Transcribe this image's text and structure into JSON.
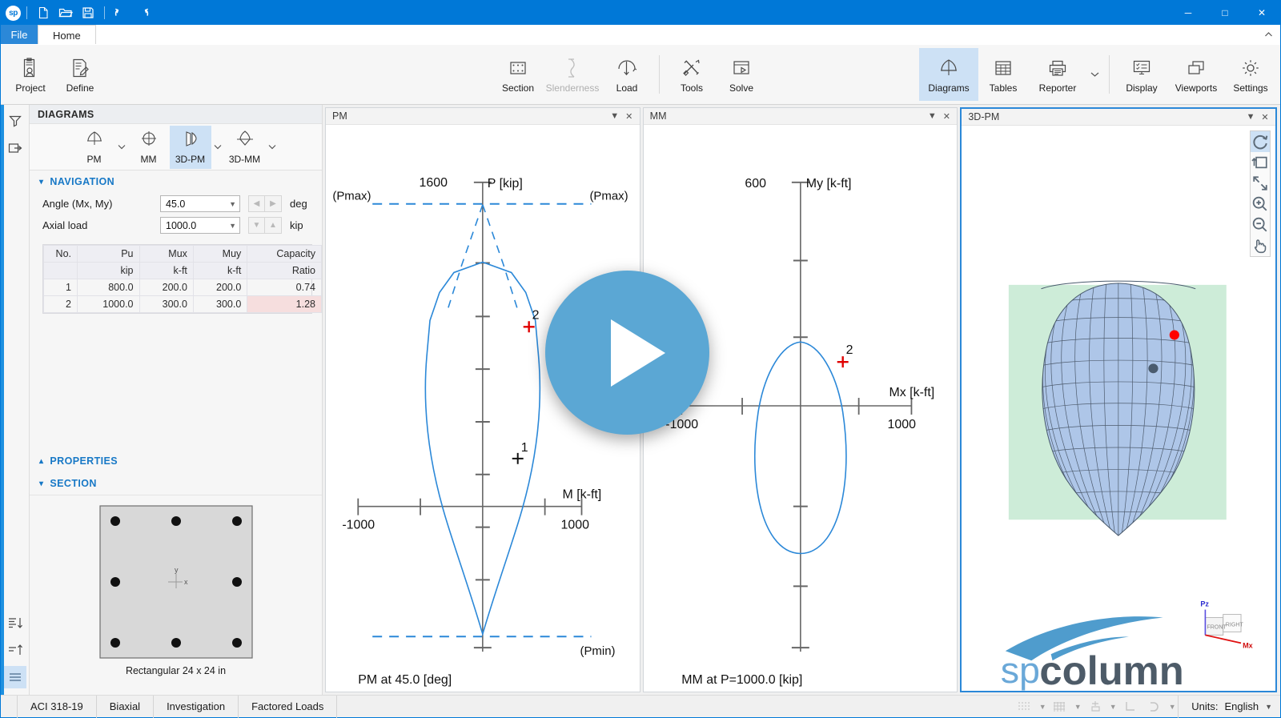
{
  "window": {
    "quick_access": [
      "sp-logo",
      "new-icon",
      "open-icon",
      "save-icon",
      "undo-icon",
      "redo-icon"
    ],
    "minimize": "─",
    "maximize": "□",
    "close": "✕"
  },
  "tabs": {
    "file": "File",
    "home": "Home"
  },
  "ribbon": {
    "left": [
      {
        "label": "Project",
        "icon": "project-icon",
        "state": "normal"
      },
      {
        "label": "Define",
        "icon": "define-icon",
        "state": "normal"
      }
    ],
    "center": [
      {
        "label": "Section",
        "icon": "section-icon",
        "state": "normal"
      },
      {
        "label": "Slenderness",
        "icon": "slenderness-icon",
        "state": "disabled"
      },
      {
        "label": "Load",
        "icon": "load-icon",
        "state": "normal"
      },
      {
        "label": "Tools",
        "icon": "tools-icon",
        "state": "normal"
      },
      {
        "label": "Solve",
        "icon": "solve-icon",
        "state": "normal"
      }
    ],
    "right": [
      {
        "label": "Diagrams",
        "icon": "diagrams-icon",
        "state": "active"
      },
      {
        "label": "Tables",
        "icon": "tables-icon",
        "state": "normal"
      },
      {
        "label": "Reporter",
        "icon": "reporter-icon",
        "state": "normal"
      },
      {
        "label": "Display",
        "icon": "display-icon",
        "state": "normal"
      },
      {
        "label": "Viewports",
        "icon": "viewports-icon",
        "state": "normal"
      },
      {
        "label": "Settings",
        "icon": "settings-icon",
        "state": "normal"
      }
    ]
  },
  "left_panel": {
    "title": "DIAGRAMS",
    "diagram_buttons": [
      {
        "label": "PM",
        "active": false,
        "caret": true
      },
      {
        "label": "MM",
        "active": false,
        "caret": false
      },
      {
        "label": "3D-PM",
        "active": true,
        "caret": true
      },
      {
        "label": "3D-MM",
        "active": false,
        "caret": true
      }
    ],
    "navigation": {
      "header": "NAVIGATION",
      "angle_label": "Angle (Mx, My)",
      "angle_value": "45.0",
      "angle_unit": "deg",
      "axial_label": "Axial load",
      "axial_value": "1000.0",
      "axial_unit": "kip"
    },
    "table": {
      "headers": [
        "No.",
        "Pu",
        "Mux",
        "Muy",
        "Capacity"
      ],
      "units": [
        "",
        "kip",
        "k-ft",
        "k-ft",
        "Ratio"
      ],
      "rows": [
        {
          "cells": [
            "1",
            "800.0",
            "200.0",
            "200.0",
            "0.74"
          ],
          "highlight": false
        },
        {
          "cells": [
            "2",
            "1000.0",
            "300.0",
            "300.0",
            "1.28"
          ],
          "highlight": true
        }
      ]
    },
    "properties_header": "PROPERTIES",
    "section_header": "SECTION",
    "section_caption": "Rectangular 24 x 24 in",
    "section_axis_x": "x",
    "section_axis_y": "y"
  },
  "panes": [
    {
      "title": "PM",
      "has_caret": true,
      "has_close": true,
      "focused": false
    },
    {
      "title": "MM",
      "has_caret": true,
      "has_close": true,
      "focused": false
    },
    {
      "title": "3D-PM",
      "has_caret": true,
      "has_close": true,
      "focused": true
    }
  ],
  "view_tools": [
    "rotate-icon",
    "orbit-icon",
    "zoom-extents-icon",
    "zoom-in-icon",
    "zoom-out-icon",
    "pan-icon"
  ],
  "axis_triad": {
    "z": "Pz",
    "x": "Mx",
    "front": "FRONT",
    "right": "RIGHT"
  },
  "logo": {
    "sp": "sp",
    "column": "column"
  },
  "status_bar": {
    "cells": [
      "ACI 318-19",
      "Biaxial",
      "Investigation",
      "Factored Loads"
    ],
    "icons": [
      "dot-grid-icon",
      "grid-icon",
      "snap-icon",
      "ortho-icon",
      "magnet-icon"
    ],
    "units_label": "Units:",
    "units_value": "English"
  },
  "chart_data": [
    {
      "type": "line",
      "id": "pm-diagram",
      "title": "PM at 45.0 [deg]",
      "xlabel": "M [k-ft]",
      "ylabel": "P [kip]",
      "xlim": [
        -1400,
        1400
      ],
      "ylim": [
        -700,
        1600
      ],
      "x_ticks": [
        -1000,
        -500,
        0,
        500,
        1000
      ],
      "x_tick_labels": {
        "-1000": "-1000",
        "1000": "1000"
      },
      "y_axis_top_label": "1600",
      "annotations": [
        {
          "text": "(Pmax)",
          "side": "left"
        },
        {
          "text": "(Pmax)",
          "side": "right"
        },
        {
          "text": "(Pmin)",
          "side": "right"
        }
      ],
      "points": [
        {
          "label": "1",
          "x": 283,
          "y": 800,
          "color": "#000000"
        },
        {
          "label": "2",
          "x": 424,
          "y": 1000,
          "color": "#ff0000"
        }
      ],
      "curve_color": "#1f7fc4",
      "grid": false,
      "legend": "none"
    },
    {
      "type": "line",
      "id": "mm-diagram",
      "title": "MM at P=1000.0 [kip]",
      "xlabel": "Mx [k-ft]",
      "ylabel": "My [k-ft]",
      "xlim": [
        -1400,
        1400
      ],
      "ylim": [
        -1600,
        600
      ],
      "x_ticks": [
        -1000,
        -500,
        0,
        500,
        1000
      ],
      "x_tick_labels": {
        "-1000": "-1000",
        "1000": "1000"
      },
      "y_axis_top_label": "600",
      "points": [
        {
          "label": "2",
          "x": 300,
          "y": 300,
          "color": "#ff0000"
        }
      ],
      "curve_color": "#1f7fc4",
      "grid": false,
      "legend": "none"
    },
    {
      "type": "surface",
      "id": "3d-pm-surface",
      "title": "3D-PM",
      "surface_color": "#aec6e8",
      "background_color": "#ccecd6",
      "points": [
        {
          "label": "2",
          "color": "#ff0000"
        },
        {
          "label": "1",
          "color": "#4a5b6e"
        }
      ]
    }
  ]
}
